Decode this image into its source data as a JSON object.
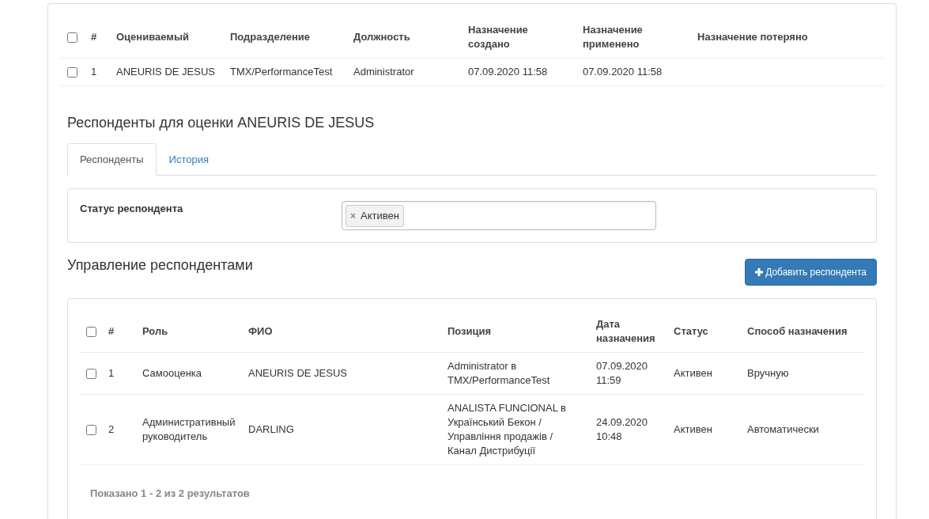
{
  "assignments": {
    "select_all": {
      "checked": false
    },
    "columns": [
      "#",
      "Оцениваемый",
      "Подразделение",
      "Должность",
      "Назначение создано",
      "Назначение применено",
      "Назначение потеряно"
    ],
    "rows": [
      {
        "checked": false,
        "cells": [
          "1",
          "ANEURIS DE JESUS",
          "TMX/PerformanceTest",
          "Administrator",
          "07.09.2020 11:58",
          "07.09.2020 11:58"
        ]
      }
    ]
  },
  "respondents_title": "Респонденты для оценки ANEURIS DE JESUS",
  "tabs": [
    {
      "label": "Респонденты",
      "selected": true
    },
    {
      "label": "История",
      "selected": false
    }
  ],
  "filter": {
    "label": "Статус респондента",
    "tags": [
      {
        "remove": "×",
        "label": "Активен"
      }
    ]
  },
  "management": {
    "title": "Управление респондентами",
    "add_button": "Добавить респондента",
    "select_all": {
      "checked": false
    },
    "columns": [
      "#",
      "Роль",
      "ФИО",
      "Позиция",
      "Дата назначения",
      "Статус",
      "Способ назначения"
    ],
    "rows": [
      {
        "checked": false,
        "cells": [
          "1",
          "Самооценка",
          "ANEURIS DE JESUS",
          "Administrator в TMX/PerformanceTest",
          "07.09.2020 11:59",
          "Активен",
          "Вручную"
        ]
      },
      {
        "checked": false,
        "cells": [
          "2",
          "Административный руководитель",
          "DARLING",
          "ANALISTA FUNCIONAL в Український Бекон / Управління продажів / Канал Дистрибуції",
          "24.09.2020 10:48",
          "Активен",
          "Автоматически"
        ]
      }
    ],
    "summary": "Показано 1 - 2 из 2 результатов"
  }
}
